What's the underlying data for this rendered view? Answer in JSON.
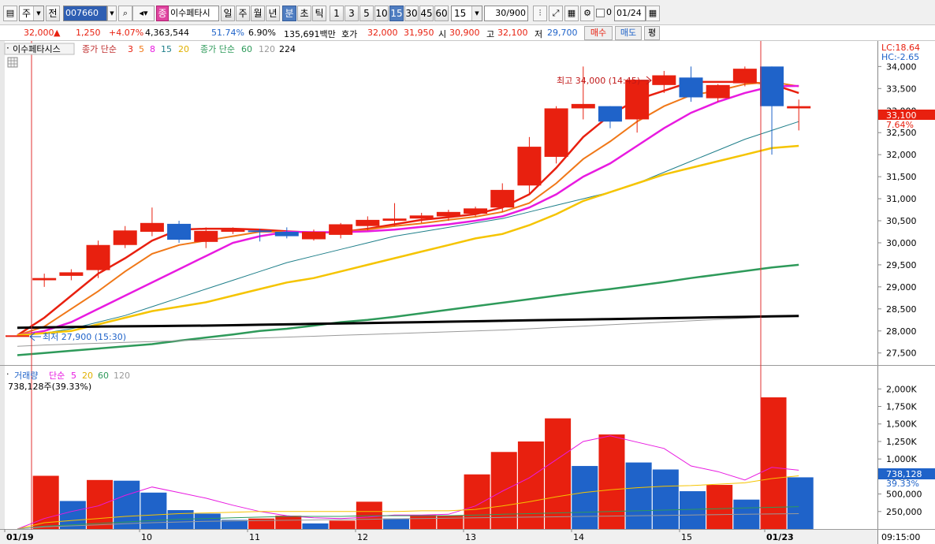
{
  "toolbar": {
    "period_label": "주",
    "prev_label": "전",
    "code_value": "007660",
    "stock_name": "이수페타시",
    "stock_badge": "종",
    "periods": [
      "일",
      "주",
      "월",
      "년",
      "분",
      "초",
      "틱"
    ],
    "active_period": "분",
    "intervals": [
      "1",
      "3",
      "5",
      "10",
      "15",
      "30",
      "45",
      "60"
    ],
    "active_interval": "15",
    "interval_select": "15",
    "count_value": "30/900",
    "date_value": "01/24",
    "check_label": "0"
  },
  "quote": {
    "price": "32,000",
    "change": "1,250",
    "change_pct": "+4.07%",
    "volume": "4,363,544",
    "vol_ratio": "51.74%",
    "turnover": "6.90%",
    "amount": "135,691백만",
    "bid_label": "호가",
    "ask_price": "32,000",
    "bid_price": "31,950",
    "open_label": "시",
    "open": "30,900",
    "high_label": "고",
    "high": "32,100",
    "low_label": "저",
    "low": "29,700",
    "buy_label": "매수",
    "sell_label": "매도",
    "eval_label": "평"
  },
  "legend": {
    "name": "이수페타시스",
    "ma_label": "종가 단순",
    "ma_periods": [
      "3",
      "5",
      "8",
      "15",
      "20"
    ],
    "ma2_label": "종가 단순",
    "ma2_periods": [
      "60",
      "120",
      "224"
    ],
    "vol_label": "거래량",
    "vol_ma_label": "단순",
    "vol_periods": [
      "5",
      "20",
      "60",
      "120"
    ],
    "vol_value": "738,128주(39.33%)"
  },
  "right_info": {
    "lc": "LC:18.64",
    "hc": "HC:-2.65",
    "price": "33,100",
    "pct": "7.64%",
    "vol": "738,128",
    "vol_pct": "39.33%"
  },
  "annotations": {
    "high": "최고 34,000 (14:45)",
    "low": "최저 27,900 (15:30)"
  },
  "x_axis": {
    "labels": [
      "01/19",
      "10",
      "11",
      "12",
      "13",
      "14",
      "15",
      "01/23"
    ],
    "time": "09:15:00"
  },
  "colors": {
    "up": "#e8200f",
    "down": "#1f63c9",
    "ma3": "#e8200f",
    "ma5": "#f07818",
    "ma8": "#e81ae0",
    "ma15": "#1f7f8a",
    "ma20": "#f5c400",
    "ma60": "#2e9a5a",
    "ma120": "#9a9a9a",
    "ma224": "#000000"
  },
  "chart_data": [
    {
      "type": "candlestick",
      "title": "",
      "y_ticks": [
        27500,
        28000,
        28500,
        29000,
        29500,
        30000,
        30500,
        31000,
        31500,
        32000,
        32500,
        33000,
        33500,
        34000
      ],
      "ylim": [
        27280,
        34400
      ],
      "candles": [
        {
          "x": "01/19 09:00",
          "o": 27900,
          "h": 27900,
          "l": 27900,
          "c": 27900
        },
        {
          "x": "01/19 09:15",
          "o": 29150,
          "h": 29300,
          "l": 29000,
          "c": 29200
        },
        {
          "x": "01/19 09:30",
          "o": 29250,
          "h": 29400,
          "l": 29150,
          "c": 29330
        },
        {
          "x": "01/19 09:45",
          "o": 29380,
          "h": 30050,
          "l": 29200,
          "c": 29950
        },
        {
          "x": "01/19 10:00",
          "o": 29950,
          "h": 30380,
          "l": 29880,
          "c": 30280
        },
        {
          "x": "01/19 10:15",
          "o": 30250,
          "h": 30800,
          "l": 30150,
          "c": 30450
        },
        {
          "x": "01/19 10:30",
          "o": 30430,
          "h": 30500,
          "l": 30000,
          "c": 30070
        },
        {
          "x": "01/19 10:45",
          "o": 30020,
          "h": 30350,
          "l": 29880,
          "c": 30270
        },
        {
          "x": "01/19 11:00",
          "o": 30250,
          "h": 30350,
          "l": 30200,
          "c": 30300
        },
        {
          "x": "01/19 11:15",
          "o": 30280,
          "h": 30320,
          "l": 30030,
          "c": 30250
        },
        {
          "x": "01/19 11:30",
          "o": 30250,
          "h": 30350,
          "l": 30100,
          "c": 30150
        },
        {
          "x": "01/19 11:45",
          "o": 30080,
          "h": 30300,
          "l": 30050,
          "c": 30250
        },
        {
          "x": "01/19 12:00",
          "o": 30180,
          "h": 30450,
          "l": 30100,
          "c": 30420
        },
        {
          "x": "01/19 12:15",
          "o": 30380,
          "h": 30600,
          "l": 30280,
          "c": 30520
        },
        {
          "x": "01/19 12:30",
          "o": 30500,
          "h": 30900,
          "l": 30380,
          "c": 30550
        },
        {
          "x": "01/19 12:45",
          "o": 30550,
          "h": 30680,
          "l": 30450,
          "c": 30620
        },
        {
          "x": "01/19 13:00",
          "o": 30600,
          "h": 30750,
          "l": 30500,
          "c": 30700
        },
        {
          "x": "01/19 13:15",
          "o": 30660,
          "h": 30820,
          "l": 30600,
          "c": 30780
        },
        {
          "x": "01/19 13:30",
          "o": 30800,
          "h": 31350,
          "l": 30700,
          "c": 31200
        },
        {
          "x": "01/19 13:45",
          "o": 31300,
          "h": 32400,
          "l": 31100,
          "c": 32180
        },
        {
          "x": "01/19 14:00",
          "o": 31950,
          "h": 33100,
          "l": 31800,
          "c": 33050
        },
        {
          "x": "01/19 14:15",
          "o": 33050,
          "h": 34000,
          "l": 32800,
          "c": 33150
        },
        {
          "x": "01/19 14:30",
          "o": 33100,
          "h": 33100,
          "l": 32600,
          "c": 32750
        },
        {
          "x": "01/19 14:45",
          "o": 32800,
          "h": 33700,
          "l": 32500,
          "c": 33700
        },
        {
          "x": "01/19 15:00",
          "o": 33580,
          "h": 33900,
          "l": 33400,
          "c": 33800
        },
        {
          "x": "01/19 15:15",
          "o": 33750,
          "h": 34000,
          "l": 33200,
          "c": 33300
        },
        {
          "x": "01/19 15:30",
          "o": 33280,
          "h": 33600,
          "l": 33200,
          "c": 33580
        },
        {
          "x": "01/19 15:45",
          "o": 33620,
          "h": 34000,
          "l": 33550,
          "c": 33950
        },
        {
          "x": "01/23 09:00",
          "o": 34000,
          "h": 34000,
          "l": 32000,
          "c": 33100
        },
        {
          "x": "01/23 09:15",
          "o": 33050,
          "h": 33250,
          "l": 32550,
          "c": 33100
        }
      ],
      "series": [
        {
          "name": "3",
          "values": [
            27900,
            28300,
            28800,
            29300,
            29650,
            30050,
            30300,
            30320,
            30320,
            30300,
            30260,
            30230,
            30240,
            30320,
            30420,
            30520,
            30580,
            30650,
            30800,
            31100,
            31700,
            32400,
            32900,
            33250,
            33450,
            33650,
            33650,
            33650,
            33600,
            33400
          ]
        },
        {
          "name": "5",
          "values": [
            27900,
            28100,
            28500,
            28900,
            29350,
            29750,
            29950,
            30050,
            30150,
            30250,
            30250,
            30230,
            30240,
            30300,
            30380,
            30440,
            30520,
            30590,
            30700,
            30900,
            31350,
            31900,
            32300,
            32750,
            33100,
            33350,
            33450,
            33600,
            33650,
            33550
          ]
        },
        {
          "name": "8",
          "values": [
            27900,
            28000,
            28200,
            28500,
            28800,
            29100,
            29400,
            29700,
            30000,
            30150,
            30250,
            30240,
            30240,
            30260,
            30300,
            30360,
            30420,
            30500,
            30600,
            30800,
            31100,
            31500,
            31800,
            32200,
            32600,
            32950,
            33200,
            33400,
            33550,
            33560
          ]
        },
        {
          "name": "15",
          "values": [
            27900,
            27950,
            28050,
            28200,
            28350,
            28550,
            28750,
            28950,
            29150,
            29350,
            29550,
            29700,
            29850,
            30000,
            30150,
            30250,
            30350,
            30450,
            30550,
            30700,
            30850,
            31000,
            31150,
            31350,
            31600,
            31850,
            32100,
            32350,
            32550,
            32750
          ]
        },
        {
          "name": "20",
          "values": [
            27900,
            27950,
            28000,
            28150,
            28300,
            28450,
            28550,
            28650,
            28800,
            28950,
            29100,
            29200,
            29350,
            29500,
            29650,
            29800,
            29950,
            30100,
            30200,
            30400,
            30650,
            30950,
            31150,
            31350,
            31550,
            31700,
            31850,
            32000,
            32150,
            32200
          ]
        },
        {
          "name": "60",
          "values": [
            27450,
            27500,
            27550,
            27600,
            27650,
            27700,
            27780,
            27850,
            27920,
            28000,
            28050,
            28120,
            28200,
            28250,
            28320,
            28400,
            28480,
            28560,
            28640,
            28720,
            28800,
            28880,
            28950,
            29030,
            29110,
            29200,
            29280,
            29360,
            29440,
            29500
          ]
        },
        {
          "name": "120",
          "values": [
            27650,
            27680,
            27700,
            27720,
            27740,
            27760,
            27780,
            27800,
            27820,
            27840,
            27860,
            27880,
            27900,
            27920,
            27940,
            27960,
            27980,
            28000,
            28020,
            28050,
            28080,
            28110,
            28140,
            28170,
            28200,
            28230,
            28260,
            28290,
            28320,
            28340
          ]
        },
        {
          "name": "224",
          "values": [
            28070,
            28080,
            28090,
            28100,
            28105,
            28110,
            28115,
            28120,
            28130,
            28140,
            28150,
            28160,
            28170,
            28180,
            28190,
            28200,
            28210,
            28220,
            28230,
            28240,
            28250,
            28260,
            28270,
            28280,
            28290,
            28300,
            28310,
            28320,
            28330,
            28340
          ]
        }
      ]
    },
    {
      "type": "bar",
      "title": "",
      "y_ticks": [
        250000,
        500000,
        750000,
        1000000,
        1250000,
        1500000,
        1750000,
        2000000
      ],
      "ylim": [
        0,
        2150000
      ],
      "values": [
        0,
        760000,
        400000,
        700000,
        690000,
        520000,
        270000,
        220000,
        130000,
        150000,
        190000,
        80000,
        120000,
        390000,
        150000,
        200000,
        190000,
        780000,
        1100000,
        1250000,
        1580000,
        900000,
        1350000,
        950000,
        850000,
        540000,
        630000,
        420000,
        1880000,
        738128
      ],
      "up": [
        true,
        true,
        false,
        true,
        false,
        false,
        false,
        false,
        false,
        true,
        true,
        false,
        true,
        true,
        false,
        true,
        true,
        true,
        true,
        true,
        true,
        false,
        true,
        false,
        false,
        false,
        true,
        false,
        true,
        false
      ],
      "series": [
        {
          "name": "5",
          "values": [
            0,
            150000,
            250000,
            330000,
            480000,
            600000,
            520000,
            440000,
            340000,
            250000,
            190000,
            160000,
            150000,
            170000,
            200000,
            200000,
            210000,
            330000,
            540000,
            730000,
            990000,
            1250000,
            1330000,
            1240000,
            1150000,
            900000,
            820000,
            700000,
            880000,
            840000
          ]
        },
        {
          "name": "20",
          "values": [
            0,
            90000,
            120000,
            150000,
            180000,
            200000,
            220000,
            230000,
            240000,
            250000,
            250000,
            250000,
            250000,
            250000,
            250000,
            260000,
            260000,
            280000,
            330000,
            390000,
            460000,
            520000,
            560000,
            590000,
            610000,
            620000,
            640000,
            660000,
            720000,
            760000
          ]
        },
        {
          "name": "60",
          "values": [
            0,
            40000,
            60000,
            80000,
            100000,
            120000,
            140000,
            150000,
            160000,
            170000,
            180000,
            180000,
            180000,
            190000,
            190000,
            190000,
            190000,
            200000,
            210000,
            220000,
            230000,
            240000,
            250000,
            260000,
            270000,
            280000,
            290000,
            300000,
            310000,
            320000
          ]
        },
        {
          "name": "120",
          "values": [
            0,
            30000,
            45000,
            60000,
            75000,
            90000,
            100000,
            110000,
            115000,
            120000,
            125000,
            130000,
            135000,
            140000,
            145000,
            150000,
            155000,
            160000,
            165000,
            170000,
            175000,
            180000,
            185000,
            190000,
            195000,
            200000,
            205000,
            210000,
            215000,
            220000
          ]
        }
      ]
    }
  ]
}
